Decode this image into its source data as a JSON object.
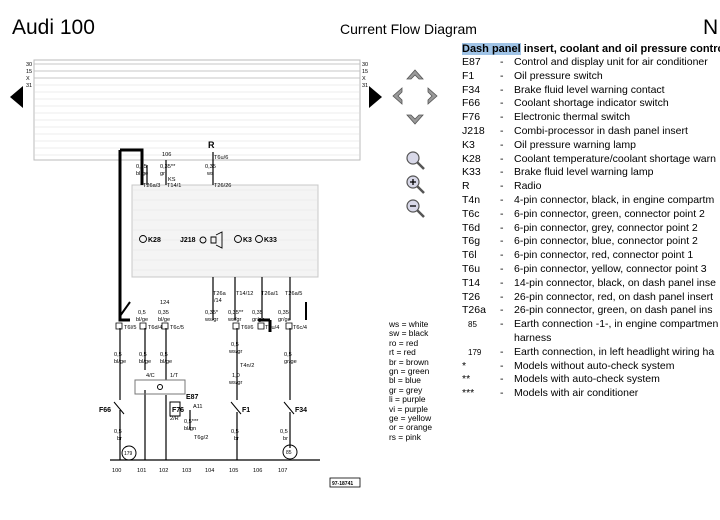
{
  "header": {
    "app_title": "Audi 100",
    "diagram_title": "Current Flow Diagram",
    "page_mark": "N"
  },
  "legend": {
    "title_highlight": "Dash panel",
    "title_rest": " insert, coolant and oil pressure contro",
    "items": [
      {
        "code": "E87",
        "dash": "-",
        "desc": "Control and display unit for air conditioner"
      },
      {
        "code": "F1",
        "dash": "-",
        "desc": "Oil pressure switch"
      },
      {
        "code": "F34",
        "dash": "-",
        "desc": "Brake fluid level warning contact"
      },
      {
        "code": "F66",
        "dash": "-",
        "desc": "Coolant shortage indicator switch"
      },
      {
        "code": "F76",
        "dash": "-",
        "desc": "Electronic thermal switch"
      },
      {
        "code": "J218",
        "dash": "-",
        "desc": "Combi-processor in dash panel insert"
      },
      {
        "code": "K3",
        "dash": "-",
        "desc": "Oil pressure warning lamp"
      },
      {
        "code": "K28",
        "dash": "-",
        "desc": "Coolant temperature/coolant shortage warn"
      },
      {
        "code": "K33",
        "dash": "-",
        "desc": "Brake fluid level warning lamp"
      },
      {
        "code": "R",
        "dash": "-",
        "desc": "Radio"
      },
      {
        "code": "T4n",
        "dash": "-",
        "desc": "4-pin connector, black, in engine compartm"
      },
      {
        "code": "T6c",
        "dash": "-",
        "desc": "6-pin connector, green, connector point 2"
      },
      {
        "code": "T6d",
        "dash": "-",
        "desc": "6-pin connector, grey, connector point 2"
      },
      {
        "code": "T6g",
        "dash": "-",
        "desc": "6-pin connector, blue, connector point 2"
      },
      {
        "code": "T6l",
        "dash": "-",
        "desc": "6-pin connector, red, connector point 1"
      },
      {
        "code": "T6u",
        "dash": "-",
        "desc": "6-pin connector, yellow, connector point 3"
      },
      {
        "code": "T14",
        "dash": "-",
        "desc": "14-pin connector, black, on dash panel inse"
      },
      {
        "code": "T26",
        "dash": "-",
        "desc": "26-pin connector, red, on dash panel insert"
      },
      {
        "code": "T26a",
        "dash": "-",
        "desc": "26-pin connector, green, on dash panel ins"
      },
      {
        "code": "85",
        "dash": "-",
        "desc": "Earth connection -1-, in engine compartmen harness",
        "symbol": true
      },
      {
        "code": "179",
        "dash": "-",
        "desc": "Earth connection, in left headlight wiring ha",
        "symbol": true
      },
      {
        "code": "*",
        "dash": "-",
        "desc": "Models without auto-check system"
      },
      {
        "code": "**",
        "dash": "-",
        "desc": "Models with auto-check system"
      },
      {
        "code": "***",
        "dash": "-",
        "desc": "Models with air conditioner"
      }
    ]
  },
  "color_key": [
    "ws = white",
    "sw = black",
    "ro = red",
    "rt = red",
    "br = brown",
    "gn = green",
    "bl = blue",
    "gr = grey",
    "li = purple",
    "vi = purple",
    "ge = yellow",
    "or = orange",
    "rs = pink"
  ],
  "diagram": {
    "rail_labels_left": [
      "30",
      "15",
      "X",
      "31"
    ],
    "rail_labels_right": [
      "30",
      "15",
      "X",
      "31"
    ],
    "top_wires": [
      {
        "size": "0,35",
        "color": "bl/ge"
      },
      {
        "size": "0,35**",
        "color": "gr"
      },
      {
        "size": "0,35",
        "color": "ws"
      }
    ],
    "top_numbers": [
      "106",
      "R"
    ],
    "connector_labels": [
      "T6u/6",
      "T26a/3",
      "T14/1",
      "T26/26",
      "KS"
    ],
    "lamps": [
      "K28",
      "J218",
      "K3",
      "K33"
    ],
    "mid_connectors": [
      "T26a",
      "T14/12",
      "T26a/1",
      "T26a/5",
      "/14"
    ],
    "mid_wires": [
      {
        "size": "0,35*",
        "color": "ws/gr"
      },
      {
        "size": "0,35**",
        "color": "ws/gr"
      },
      {
        "size": "0,35",
        "color": "gr/ge"
      },
      {
        "size": "0,35",
        "color": "gr/ge"
      }
    ],
    "row_connectors": [
      "T6l/5",
      "T6d/4",
      "T6c/5",
      "T6l/6",
      "T6u/4",
      "T6c/4"
    ],
    "left_wires": [
      {
        "size": "0,5",
        "color": "bl/ge"
      },
      {
        "size": "0,5",
        "color": "bl/ge"
      },
      {
        "size": "0,35",
        "color": "bl/ge"
      },
      {
        "size": "0,5",
        "color": "gr/ge"
      }
    ],
    "num_124": "124",
    "lower_wires": [
      {
        "size": "0,5",
        "color": "bl/ge"
      },
      {
        "size": "0,5",
        "color": "bl/ge"
      },
      {
        "size": "0,5",
        "color": "bl/ge"
      },
      {
        "size": "0,5",
        "color": "ws/gr"
      },
      {
        "size": "0,5",
        "color": "gr/ge"
      }
    ],
    "extra_labels": [
      "T4n/2",
      "1,0",
      "ws/gr",
      "4/C",
      "1/T",
      "2/R",
      "A11",
      "0,5***",
      "bl/gn",
      "T6g/2"
    ],
    "components": [
      "F66",
      "E87",
      "F76",
      "F1",
      "F34"
    ],
    "bottom_wires": [
      {
        "size": "0,5",
        "color": "br"
      },
      {
        "size": "0,5",
        "color": "br"
      },
      {
        "size": "0,5",
        "color": "br"
      }
    ],
    "earth": [
      "179",
      "85"
    ],
    "track_numbers": [
      "100",
      "101",
      "102",
      "103",
      "104",
      "105",
      "106",
      "107"
    ],
    "ref": "97-18741"
  }
}
